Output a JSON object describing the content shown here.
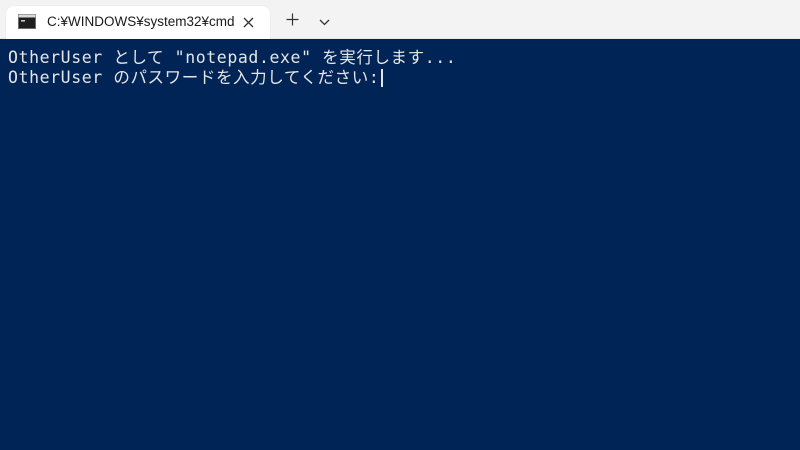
{
  "tab": {
    "title": "C:¥WINDOWS¥system32¥cmd",
    "icon": "terminal-icon",
    "close_icon": "close-icon"
  },
  "toolbar": {
    "new_tab_icon": "plus-icon",
    "dropdown_icon": "chevron-down-icon"
  },
  "terminal": {
    "lines": [
      "OtherUser として \"notepad.exe\" を実行します...",
      "OtherUser のパスワードを入力してください:"
    ]
  },
  "colors": {
    "console_background": "#012456",
    "console_text": "#e6e6e6",
    "titlebar_background": "#f3f3f3",
    "tab_background": "#ffffff"
  }
}
